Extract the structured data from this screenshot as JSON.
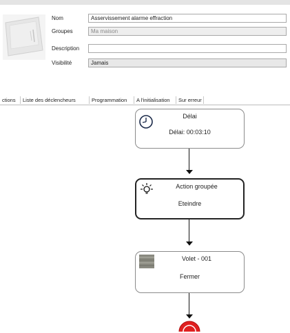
{
  "properties": {
    "name_label": "Nom",
    "name_value": "Asservissement alarme effraction",
    "groups_label": "Groupes",
    "groups_value": "Ma maison",
    "description_label": "Description",
    "description_value": "",
    "visibility_label": "Visibilité",
    "visibility_value": "Jamais"
  },
  "tabs": [
    {
      "label": "ctions",
      "active": true
    },
    {
      "label": "Liste des déclencheurs"
    },
    {
      "label": "Programmation"
    },
    {
      "label": "A l'initialisation"
    },
    {
      "label": "Sur erreur"
    }
  ],
  "flow": {
    "nodes": [
      {
        "title": "Délai",
        "body": "Délai: 00:03:10",
        "icon": "clock-icon"
      },
      {
        "title": "Action groupée",
        "body": "Eteindre",
        "icon": "lightbulb-icon",
        "selected": true
      },
      {
        "title": "Volet - 001",
        "body": "Fermer",
        "icon": "shutter-icon"
      }
    ],
    "end_icon": "stop-icon",
    "colors": {
      "end": "#e02020",
      "node_border": "#8a8a8a",
      "connector": "#111111"
    }
  }
}
